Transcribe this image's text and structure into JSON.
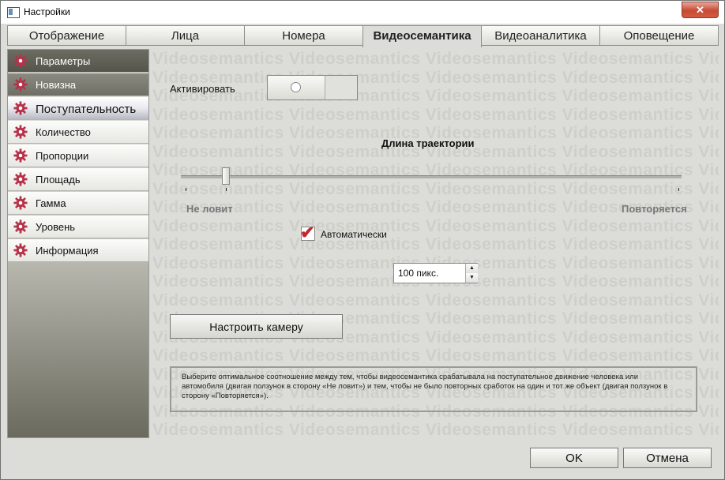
{
  "window": {
    "title": "Настройки",
    "close_glyph": "✕"
  },
  "tabs": [
    {
      "label": "Отображение"
    },
    {
      "label": "Лица"
    },
    {
      "label": "Номера"
    },
    {
      "label": "Видеосемантика",
      "active": true
    },
    {
      "label": "Видеоаналитика"
    },
    {
      "label": "Оповещение"
    }
  ],
  "sidebar": {
    "items": [
      {
        "label": "Параметры",
        "icon": "gear-icon"
      },
      {
        "label": "Новизна",
        "icon": "gear-icon"
      },
      {
        "label": "Поступательность",
        "icon": "gear-icon",
        "active": true
      },
      {
        "label": "Количество",
        "icon": "gear-icon"
      },
      {
        "label": "Пропорции",
        "icon": "gear-icon"
      },
      {
        "label": "Площадь",
        "icon": "gear-icon"
      },
      {
        "label": "Гамма",
        "icon": "gear-icon"
      },
      {
        "label": "Уровень",
        "icon": "gear-icon"
      },
      {
        "label": "Информация",
        "icon": "gear-icon"
      }
    ]
  },
  "content": {
    "watermark": "Videosemantics",
    "activate_label": "Активировать",
    "toggle_on": false,
    "slider": {
      "title": "Длина траектории",
      "min_label": "Не ловит",
      "max_label": "Повторяется",
      "position": 0.09
    },
    "auto_checkbox": {
      "label": "Автоматически",
      "checked": true
    },
    "spin": {
      "value": "100 пикс.",
      "up": "▲",
      "down": "▼"
    },
    "camera_button": "Настроить камеру",
    "help_text": "Выберите оптимальное соотношение между тем, чтобы видеосемантика срабатывала на поступательное движение человека или автомобиля (двигая ползунок в сторону «Не ловит») и тем, чтобы не было повторных сработок на один и тот же объект (двигая ползунок в сторону «Повторяется»)."
  },
  "footer": {
    "ok": "OK",
    "cancel": "Отмена"
  },
  "colors": {
    "accent": "#c0282f",
    "gear": "#b5334a"
  }
}
